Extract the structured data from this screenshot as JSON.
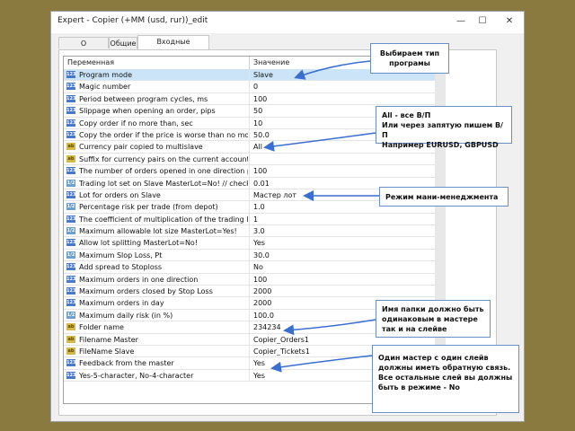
{
  "window": {
    "title": "Expert - Copier (+MM (usd, rur))_edit",
    "minimize": "—",
    "maximize": "☐",
    "close": "✕"
  },
  "tabs": [
    {
      "label": "О программе"
    },
    {
      "label": "Общие"
    },
    {
      "label": "Входные параметры",
      "active": true
    }
  ],
  "grid": {
    "col_variable": "Переменная",
    "col_value": "Значение",
    "rows": [
      {
        "icon": "n",
        "name": "Program mode",
        "value": "Slave",
        "selected": true
      },
      {
        "icon": "n",
        "name": "Magic number",
        "value": "0"
      },
      {
        "icon": "n",
        "name": "Period between program cycles, ms",
        "value": "100"
      },
      {
        "icon": "n",
        "name": "Slippage when opening an order, pips",
        "value": "50"
      },
      {
        "icon": "n",
        "name": "Copy order if no more than, sec",
        "value": "10"
      },
      {
        "icon": "n",
        "name": "Copy the order if the price is worse than no more, pips",
        "value": "50.0"
      },
      {
        "icon": "s",
        "name": "Currency pair copied to multislave",
        "value": "All"
      },
      {
        "icon": "s",
        "name": "Suffix for currency pairs on the current account (for slave)",
        "value": ""
      },
      {
        "icon": "n",
        "name": "The number of orders opened in one direction per day, pr...",
        "value": "100"
      },
      {
        "icon": "d",
        "name": "Trading lot set on Slave MasterLot=No! // check if the lot...",
        "value": "0.01"
      },
      {
        "icon": "n",
        "name": "Lot for orders on Slave",
        "value": "Мастер лот"
      },
      {
        "icon": "d",
        "name": "Percentage risk per trade (from depot)",
        "value": "1.0"
      },
      {
        "icon": "n",
        "name": "The coefficient of multiplication of the trading lot from the m",
        "value": "1"
      },
      {
        "icon": "d",
        "name": "Maximum allowable lot size MasterLot=Yes!",
        "value": "3.0"
      },
      {
        "icon": "n",
        "name": "Allow lot splitting MasterLot=No!",
        "value": "Yes"
      },
      {
        "icon": "d",
        "name": "Maximum Slop Loss, Pt",
        "value": "30.0"
      },
      {
        "icon": "n",
        "name": "Add spread to Stoploss",
        "value": "No"
      },
      {
        "icon": "n",
        "name": "Maximum orders in one direction",
        "value": "100"
      },
      {
        "icon": "n",
        "name": "Maximum orders closed by Stop Loss",
        "value": "2000"
      },
      {
        "icon": "n",
        "name": "Maximum orders in day",
        "value": "2000"
      },
      {
        "icon": "d",
        "name": "Maximum daily risk (in %)",
        "value": "100.0"
      },
      {
        "icon": "s",
        "name": "Folder name",
        "value": "234234"
      },
      {
        "icon": "s",
        "name": "Filename Master",
        "value": "Copier_Orders1"
      },
      {
        "icon": "s",
        "name": "FileName Slave",
        "value": "Copier_Tickets1"
      },
      {
        "icon": "n",
        "name": "Feedback from the master",
        "value": "Yes"
      },
      {
        "icon": "n",
        "name": "Yes-5-character, No-4-character",
        "value": "Yes"
      }
    ]
  },
  "callouts": [
    {
      "lines": [
        "Выбираем тип",
        "програмы"
      ]
    },
    {
      "lines": [
        "All - все В/П",
        "Или через запятую пишем В/П",
        "Например EURUSD, GBPUSD"
      ]
    },
    {
      "lines": [
        "Режим мани-менеджмента"
      ]
    },
    {
      "lines": [
        "Имя папки должно быть",
        "одинаковым в мастере",
        "так и на слейве"
      ]
    },
    {
      "lines": [
        "Один мастер с один слейв",
        "должны иметь обратную связь.",
        "Все остальные слей вы должны",
        "быть в режиме - No"
      ]
    }
  ],
  "colors": {
    "background": "#8a7a40",
    "selected_row": "#cce4f7",
    "arrow": "#3a6ed0"
  }
}
